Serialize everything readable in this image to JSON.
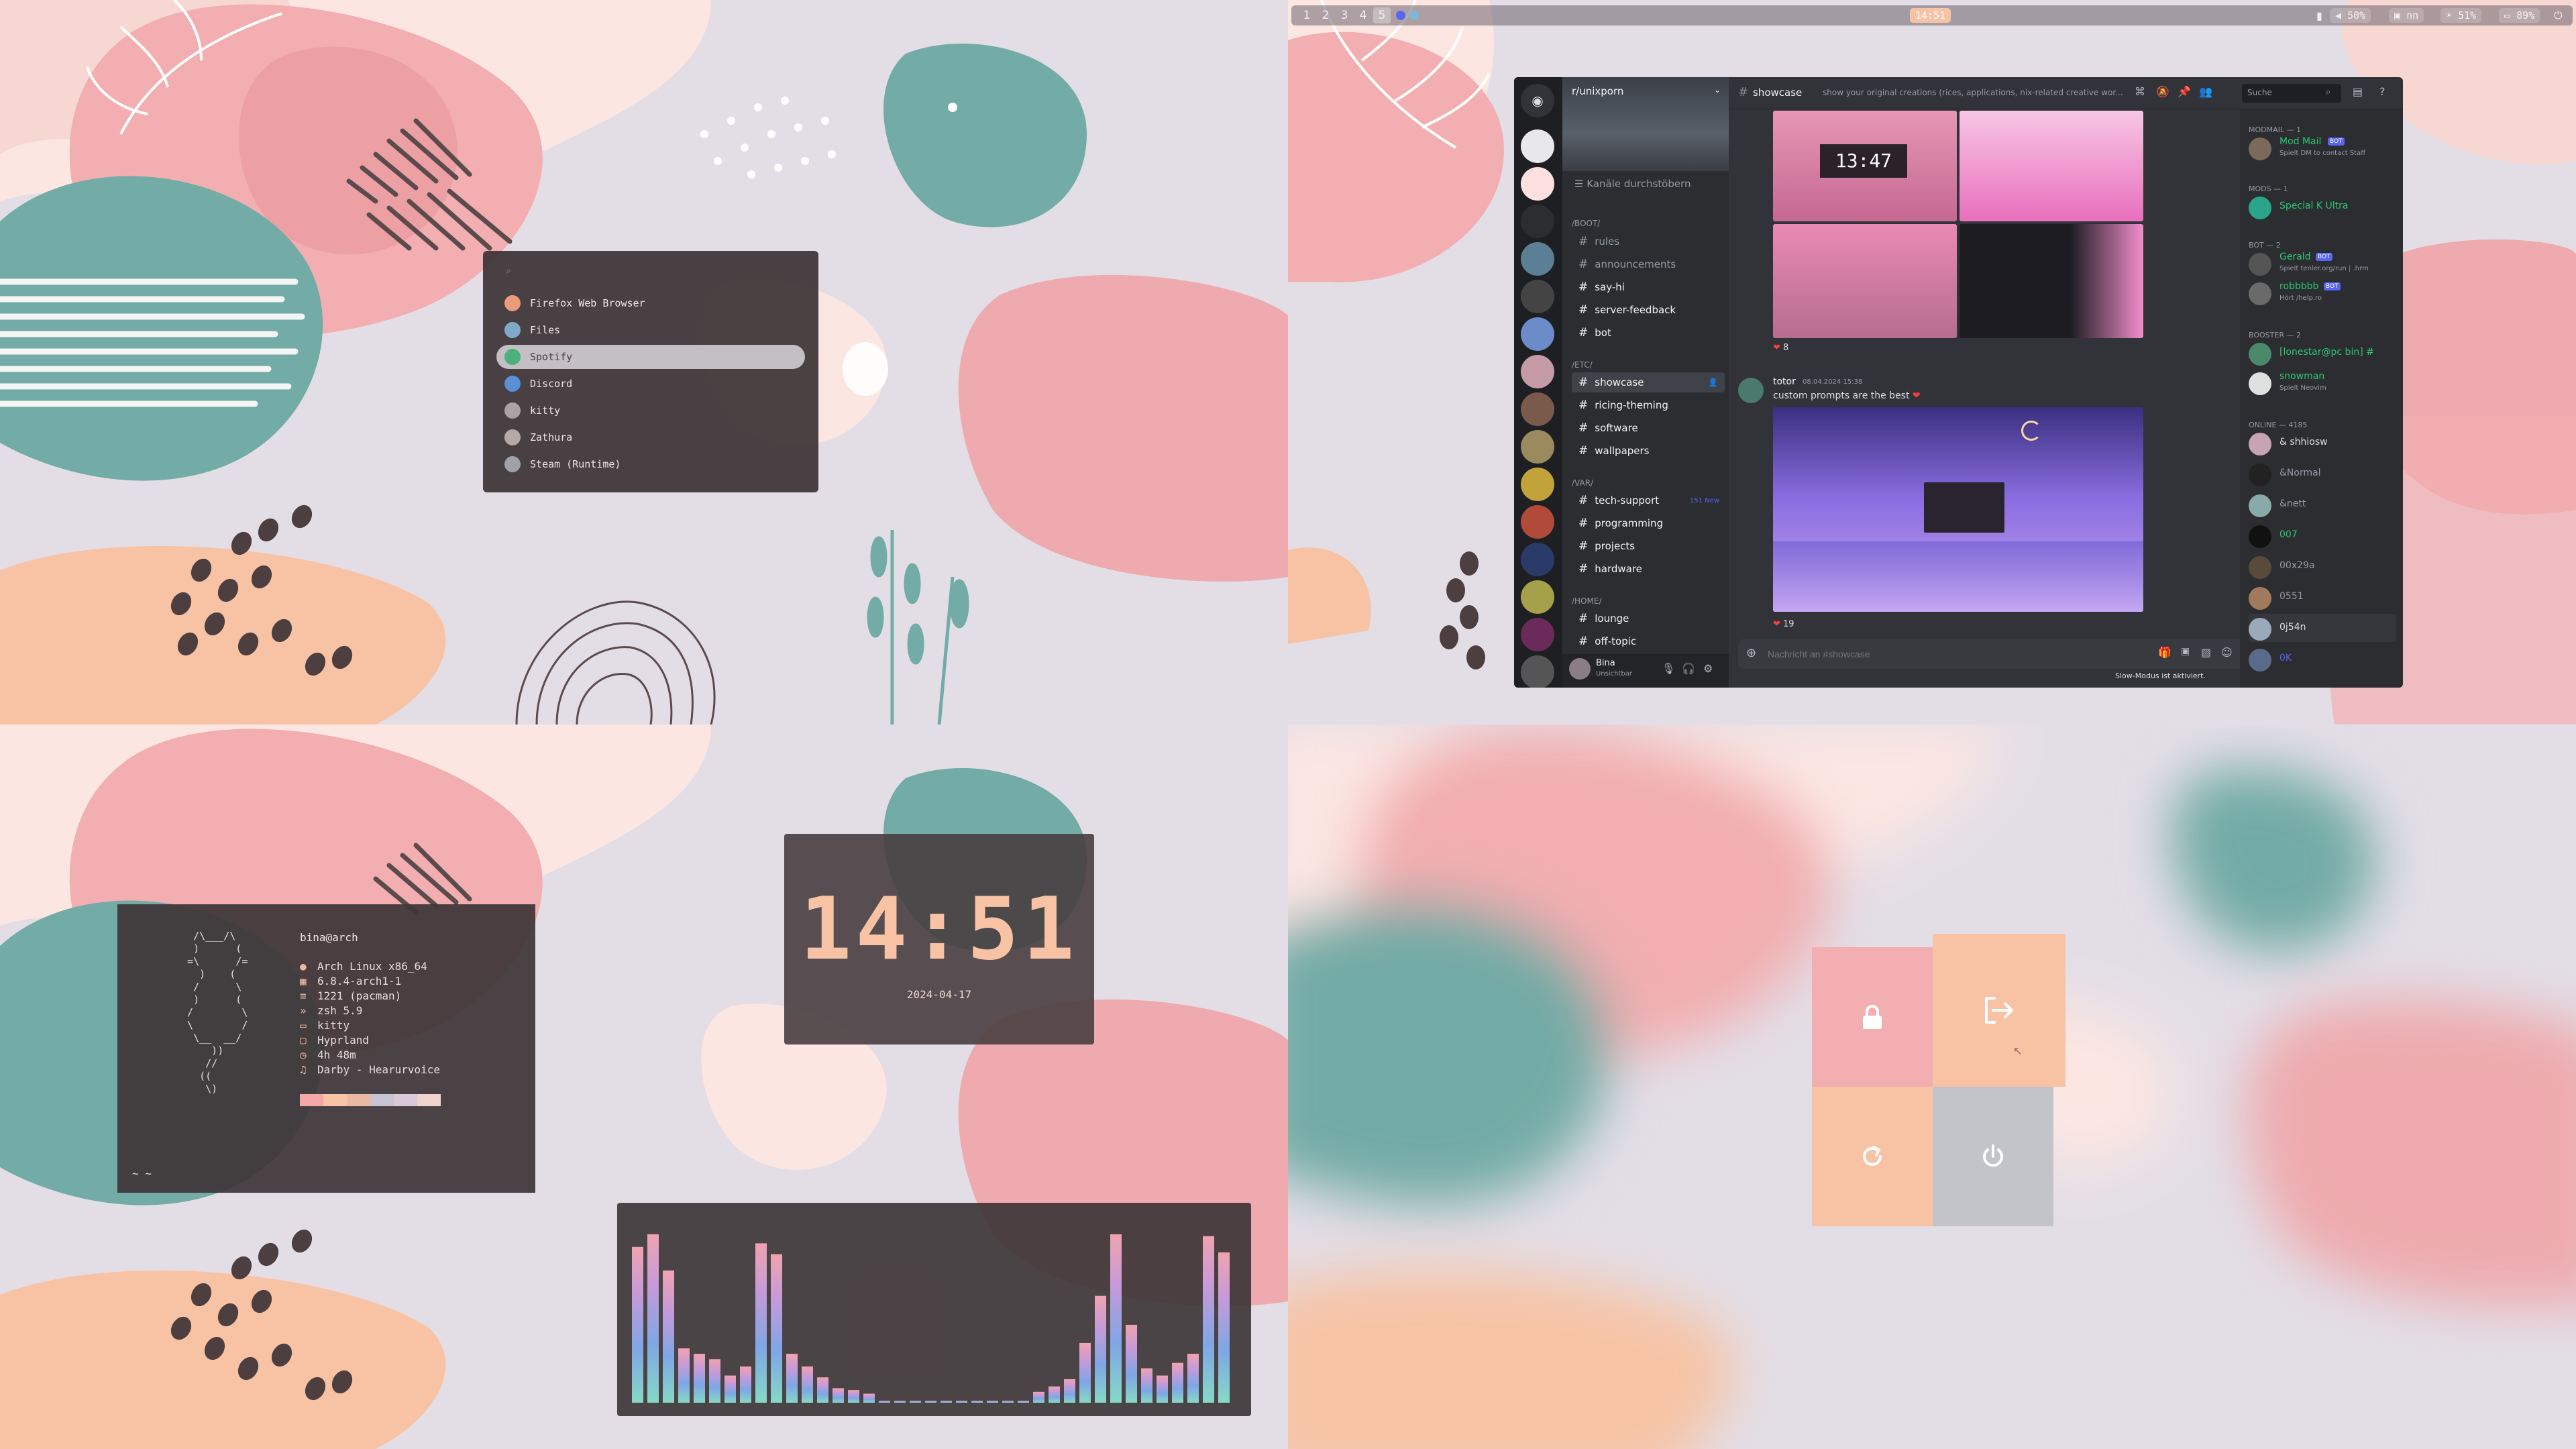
{
  "topbar": {
    "workspaces": [
      "1",
      "2",
      "3",
      "4",
      "5"
    ],
    "clock": "14:51",
    "stats": [
      "50%",
      "nn",
      "51%",
      "89%"
    ]
  },
  "launcher": {
    "search_placeholder": "",
    "apps": [
      "Firefox Web Browser",
      "Files",
      "Spotify",
      "Discord",
      "kitty",
      "Zathura",
      "Steam (Runtime)"
    ],
    "selected_index": 2
  },
  "discord": {
    "server_name": "r/unixporn",
    "browse_channels": "Kanäle durchstöbern",
    "channel_header": "showcase",
    "channel_topic": "show your original creations (rices, applications, nix-related creative wor...",
    "search_placeholder": "Suche",
    "categories": {
      "boot": "/BOOT/",
      "etc": "/ETC/",
      "var": "/VAR/",
      "home": "/HOME/"
    },
    "boot_channels": [
      "rules",
      "announcements",
      "say-hi",
      "server-feedback",
      "bot"
    ],
    "etc_channels": [
      "showcase",
      "ricing-theming",
      "software",
      "wallpapers"
    ],
    "var_channels": [
      "tech-support",
      "programming",
      "projects",
      "hardware"
    ],
    "home_channels": [
      "lounge",
      "off-topic"
    ],
    "tech_support_badge": "151 New",
    "message": {
      "reactions_first": "8",
      "author": "totor",
      "timestamp": "08.04.2024 15:38",
      "text": "custom prompts are the best",
      "reactions_second": "19",
      "screenshot_clock": "13:47"
    },
    "composer_placeholder": "Nachricht an #showcase",
    "slowmode": "Slow-Modus ist aktiviert.",
    "user": {
      "name": "Bina",
      "status": "Unsichtbar"
    },
    "members": {
      "modmail_header": "MODMAIL — 1",
      "modmail": {
        "name": "Mod Mail",
        "tag": "BOT",
        "sub": "Spielt DM to contact Staff"
      },
      "mods_header": "MODS — 1",
      "mods": {
        "name": "Special K Ultra"
      },
      "bot_header": "BOT — 2",
      "bots": [
        {
          "name": "Gerald",
          "tag": "BOT",
          "sub": "Spielt tenler.org/run | .hrm"
        },
        {
          "name": "robbbbb",
          "tag": "BOT",
          "sub": "Hört /help.ro"
        }
      ],
      "booster_header": "BOOSTER — 2",
      "boosters": [
        {
          "name": "[lonestar@pc bin] #",
          "sub": ""
        },
        {
          "name": "snowman",
          "sub": "Spielt Neovim"
        }
      ],
      "online_header": "ONLINE — 4185",
      "online": [
        {
          "name": "& shhiosw",
          "sub": ""
        },
        {
          "name": "&Normal",
          "sub": ""
        },
        {
          "name": "&nett",
          "sub": ""
        },
        {
          "name": "007",
          "sub": ""
        },
        {
          "name": "00x29a",
          "sub": ""
        },
        {
          "name": "0551",
          "sub": ""
        },
        {
          "name": "0j54n",
          "sub": ""
        },
        {
          "name": "0K",
          "sub": ""
        }
      ]
    }
  },
  "fetch": {
    "user_host": "bina@arch",
    "lines": [
      {
        "icon": "arch-icon",
        "glyph": "󰣇",
        "value": "Arch Linux x86_64"
      },
      {
        "icon": "kernel-icon",
        "glyph": "",
        "value": "6.8.4-arch1-1"
      },
      {
        "icon": "package-icon",
        "glyph": "",
        "value": "1221 (pacman)"
      },
      {
        "icon": "shell-icon",
        "glyph": "",
        "value": "zsh 5.9"
      },
      {
        "icon": "terminal-icon",
        "glyph": "",
        "value": "kitty"
      },
      {
        "icon": "wm-icon",
        "glyph": "",
        "value": "Hyprland"
      },
      {
        "icon": "uptime-icon",
        "glyph": "",
        "value": "4h 48m"
      },
      {
        "icon": "music-icon",
        "glyph": "♫",
        "value": "Darby - Hearurvoice"
      }
    ],
    "prompt": "~ ~",
    "palette": [
      "#f4a9a8",
      "#f7c4a5",
      "#e9b9a4",
      "#c8c3d3",
      "#d9c9d8",
      "#f0d3cf"
    ]
  },
  "clock": {
    "time": "14:51",
    "date": "2024-04-17"
  },
  "cava": {
    "levels": [
      0.86,
      0.93,
      0.73,
      0.3,
      0.27,
      0.24,
      0.15,
      0.2,
      0.88,
      0.82,
      0.27,
      0.2,
      0.14,
      0.08,
      0.07,
      0.05,
      0.01,
      0.01,
      0.01,
      0.01,
      0.01,
      0.01,
      0.01,
      0.01,
      0.01,
      0.01,
      0.06,
      0.09,
      0.13,
      0.33,
      0.59,
      0.93,
      0.43,
      0.19,
      0.15,
      0.22,
      0.27,
      0.92,
      0.83
    ]
  },
  "colors": {
    "bg": "#e3dee6",
    "pink": "#f2aeb0",
    "peach": "#f7c3a4",
    "teal": "#73aba6",
    "cream": "#fbe6e2",
    "discord_accent": "#5865f2",
    "lock_tile": "#f2aeb0",
    "logout_tile": "#f7c3a4",
    "reboot_tile": "#f7c3a4",
    "power_tile": "#c3c4c9"
  }
}
